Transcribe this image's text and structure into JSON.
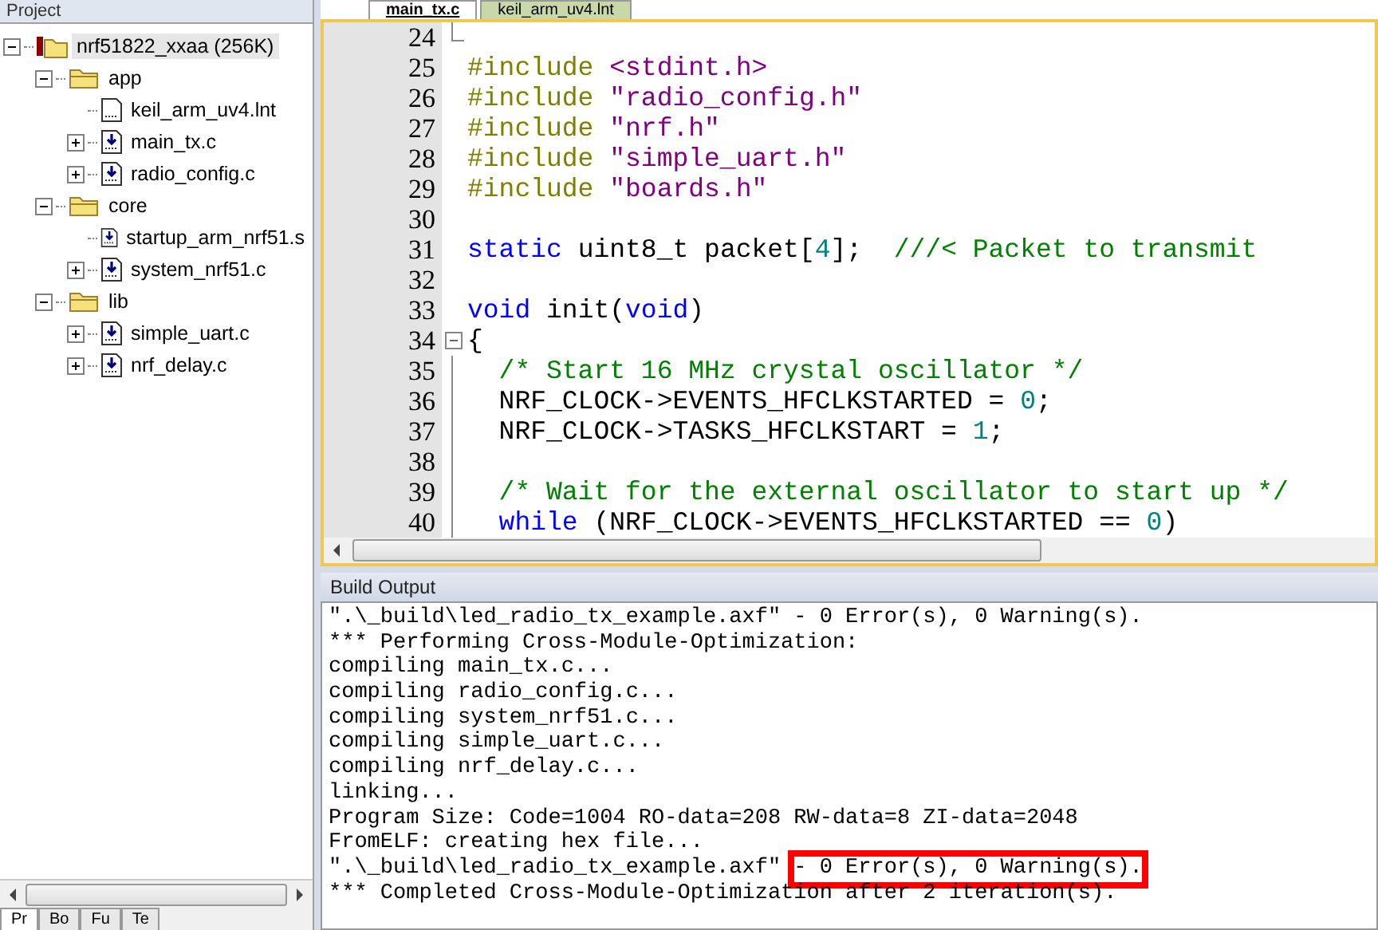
{
  "project_panel": {
    "title": "Project",
    "tree": [
      {
        "label": "nrf51822_xxaa (256K)",
        "kind": "target",
        "expanded": true,
        "selected": true,
        "children": [
          {
            "label": "app",
            "kind": "group",
            "expanded": true,
            "selected": false,
            "children": [
              {
                "label": "keil_arm_uv4.lnt",
                "kind": "text-file",
                "selected": false
              },
              {
                "label": "main_tx.c",
                "kind": "source-file",
                "expanded": false,
                "selected": false
              },
              {
                "label": "radio_config.c",
                "kind": "source-file",
                "expanded": false,
                "selected": false
              }
            ]
          },
          {
            "label": "core",
            "kind": "group",
            "expanded": true,
            "selected": false,
            "children": [
              {
                "label": "startup_arm_nrf51.s",
                "kind": "source-file",
                "selected": false
              },
              {
                "label": "system_nrf51.c",
                "kind": "source-file",
                "expanded": false,
                "selected": false
              }
            ]
          },
          {
            "label": "lib",
            "kind": "group",
            "expanded": true,
            "selected": false,
            "children": [
              {
                "label": "simple_uart.c",
                "kind": "source-file",
                "expanded": false,
                "selected": false
              },
              {
                "label": "nrf_delay.c",
                "kind": "source-file",
                "expanded": false,
                "selected": false
              }
            ]
          }
        ]
      }
    ],
    "bottom_tabs": [
      {
        "label": "Pr",
        "selected": true
      },
      {
        "label": "Bo",
        "selected": false
      },
      {
        "label": "Fu",
        "selected": false
      },
      {
        "label": "Te",
        "selected": false
      }
    ]
  },
  "editor_tabs": [
    {
      "label": "main_tx.c",
      "selected": true
    },
    {
      "label": "keil_arm_uv4.lnt",
      "selected": false
    }
  ],
  "code_lines": [
    {
      "number": "24",
      "fold_end": true
    },
    {
      "number": "25",
      "tokens": [
        {
          "kind": "directive",
          "text": "#include "
        },
        {
          "kind": "string",
          "text": "<stdint.h>"
        }
      ]
    },
    {
      "number": "26",
      "tokens": [
        {
          "kind": "directive",
          "text": "#include "
        },
        {
          "kind": "string",
          "text": "\"radio_config.h\""
        }
      ]
    },
    {
      "number": "27",
      "tokens": [
        {
          "kind": "directive",
          "text": "#include "
        },
        {
          "kind": "string",
          "text": "\"nrf.h\""
        }
      ]
    },
    {
      "number": "28",
      "tokens": [
        {
          "kind": "directive",
          "text": "#include "
        },
        {
          "kind": "string",
          "text": "\"simple_uart.h\""
        }
      ]
    },
    {
      "number": "29",
      "tokens": [
        {
          "kind": "directive",
          "text": "#include "
        },
        {
          "kind": "string",
          "text": "\"boards.h\""
        }
      ]
    },
    {
      "number": "30"
    },
    {
      "number": "31",
      "tokens": [
        {
          "kind": "keyword",
          "text": "static"
        },
        {
          "kind": "plain",
          "text": " uint8_t packet["
        },
        {
          "kind": "number",
          "text": "4"
        },
        {
          "kind": "plain",
          "text": "];  "
        },
        {
          "kind": "comment",
          "text": "///< Packet to transmit"
        }
      ]
    },
    {
      "number": "32"
    },
    {
      "number": "33",
      "tokens": [
        {
          "kind": "keyword",
          "text": "void"
        },
        {
          "kind": "plain",
          "text": " init("
        },
        {
          "kind": "keyword",
          "text": "void"
        },
        {
          "kind": "plain",
          "text": ")"
        }
      ]
    },
    {
      "number": "34",
      "fold_start": true,
      "tokens": [
        {
          "kind": "plain",
          "text": "{"
        }
      ]
    },
    {
      "number": "35",
      "in_fold": true,
      "tokens": [
        {
          "kind": "comment",
          "text": "  /* Start 16 MHz crystal oscillator */"
        }
      ]
    },
    {
      "number": "36",
      "in_fold": true,
      "tokens": [
        {
          "kind": "plain",
          "text": "  NRF_CLOCK->EVENTS_HFCLKSTARTED = "
        },
        {
          "kind": "number",
          "text": "0"
        },
        {
          "kind": "plain",
          "text": ";"
        }
      ]
    },
    {
      "number": "37",
      "in_fold": true,
      "tokens": [
        {
          "kind": "plain",
          "text": "  NRF_CLOCK->TASKS_HFCLKSTART = "
        },
        {
          "kind": "number",
          "text": "1"
        },
        {
          "kind": "plain",
          "text": ";"
        }
      ]
    },
    {
      "number": "38",
      "in_fold": true
    },
    {
      "number": "39",
      "in_fold": true,
      "tokens": [
        {
          "kind": "comment",
          "text": "  /* Wait for the external oscillator to start up */"
        }
      ]
    },
    {
      "number": "40",
      "in_fold": true,
      "tokens": [
        {
          "kind": "keyword",
          "text": "  while"
        },
        {
          "kind": "plain",
          "text": " (NRF_CLOCK->EVENTS_HFCLKSTARTED == "
        },
        {
          "kind": "number",
          "text": "0"
        },
        {
          "kind": "plain",
          "text": ")"
        }
      ]
    }
  ],
  "build_output": {
    "title": "Build Output",
    "lines": [
      {
        "text": "\".\\_build\\led_radio_tx_example.axf\" - 0 Error(s), 0 Warning(s)."
      },
      {
        "text": "*** Performing Cross-Module-Optimization:"
      },
      {
        "text": "compiling main_tx.c..."
      },
      {
        "text": "compiling radio_config.c..."
      },
      {
        "text": "compiling system_nrf51.c..."
      },
      {
        "text": "compiling simple_uart.c..."
      },
      {
        "text": "compiling nrf_delay.c..."
      },
      {
        "text": "linking..."
      },
      {
        "text": "Program Size: Code=1004 RO-data=208 RW-data=8 ZI-data=2048"
      },
      {
        "text": "FromELF: creating hex file..."
      },
      {
        "text": "\".\\_build\\led_radio_tx_example.axf\" ",
        "highlight": "- 0 Error(s), 0 Warning(s)."
      },
      {
        "text": "*** Completed Cross-Module-Optimization after 2 iteration(s)."
      }
    ]
  }
}
